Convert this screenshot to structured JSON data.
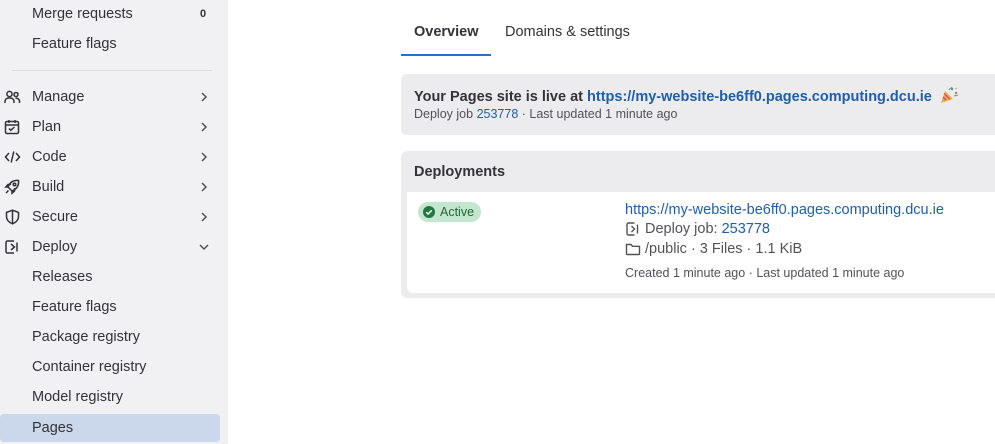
{
  "sidebar": {
    "merge_requests": {
      "label": "Merge requests",
      "count": "0"
    },
    "feature_flags_top": "Feature flags",
    "sections": [
      {
        "label": "Manage",
        "icon": "users-icon"
      },
      {
        "label": "Plan",
        "icon": "calendar-icon"
      },
      {
        "label": "Code",
        "icon": "code-icon"
      },
      {
        "label": "Build",
        "icon": "rocket-icon"
      },
      {
        "label": "Secure",
        "icon": "shield-icon"
      },
      {
        "label": "Deploy",
        "icon": "deployments-icon"
      }
    ],
    "deploy_items": [
      "Releases",
      "Feature flags",
      "Package registry",
      "Container registry",
      "Model registry",
      "Pages"
    ],
    "active_item": "Pages"
  },
  "tabs": {
    "overview": "Overview",
    "domains": "Domains & settings",
    "active": "Overview"
  },
  "live": {
    "prefix": "Your Pages site is live at",
    "url": "https://my-website-be6ff0.pages.computing.dcu.ie",
    "deploy_job_label": "Deploy job",
    "deploy_job_id": "253778",
    "last_updated": "· Last updated 1 minute ago"
  },
  "deployments": {
    "title": "Deployments",
    "status": "Active",
    "url": "https://my-website-be6ff0.pages.computing.dcu.ie",
    "deploy_job_label": "Deploy job:",
    "deploy_job_id": "253778",
    "files": "/public · 3 Files · 1.1 KiB",
    "created": "Created 1 minute ago · Last updated 1 minute ago"
  },
  "colors": {
    "link": "#1f5ea8",
    "active_nav": "#cbd7ea",
    "badge_bg": "#c3e6cd",
    "tab_underline": "#1f75cb"
  }
}
